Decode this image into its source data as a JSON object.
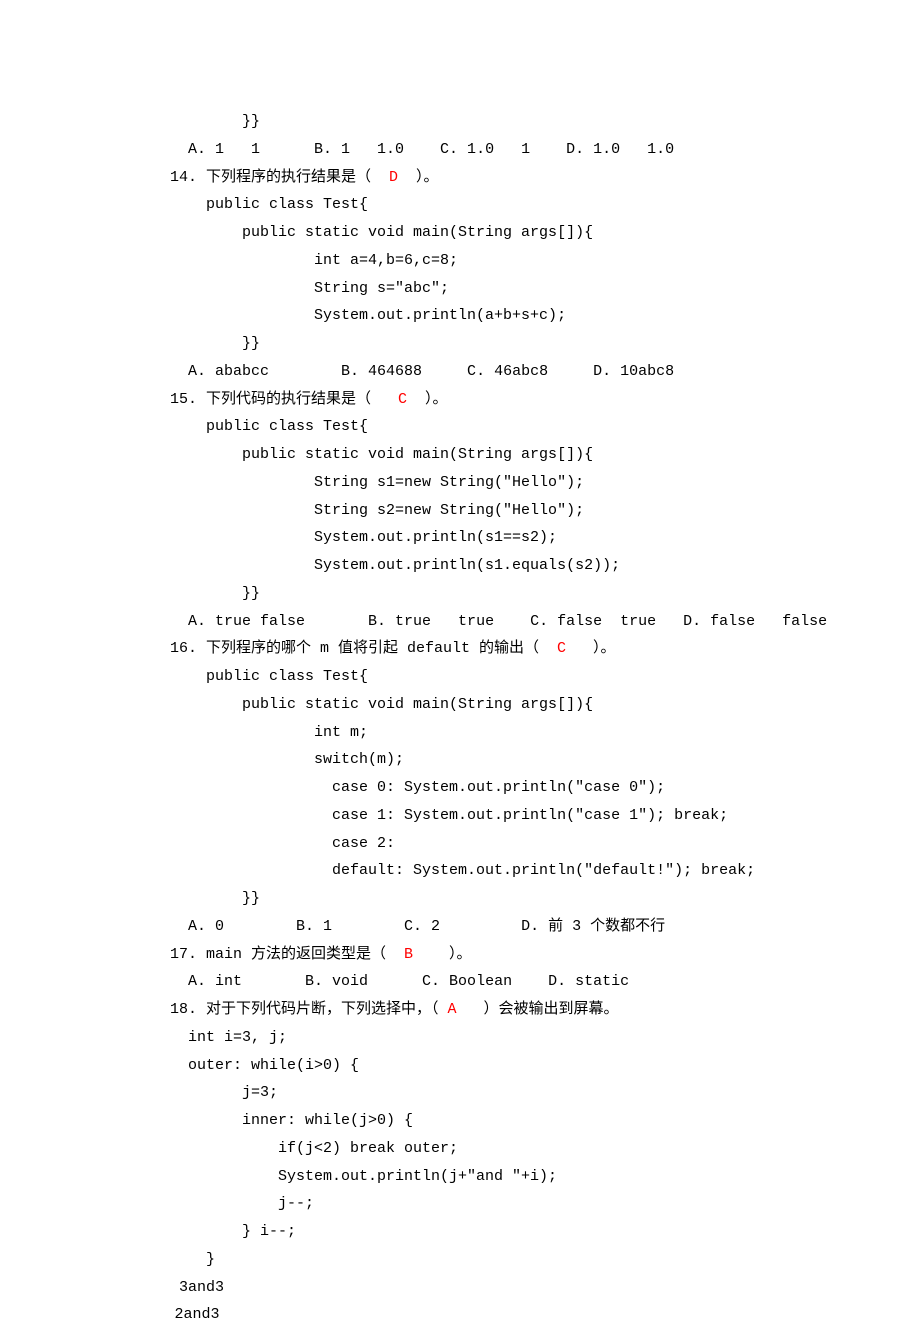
{
  "lines": [
    {
      "indent": 4,
      "text": "}}"
    },
    {
      "indent": 1,
      "segments": [
        {
          "text": "A. 1   1      B. 1   1.0    C. 1.0   1    D. 1.0   1.0"
        }
      ]
    },
    {
      "indent": 0,
      "segments": [
        {
          "text": "14. 下列程序的执行结果是（  "
        },
        {
          "text": "D",
          "red": true
        },
        {
          "text": "  ）。"
        }
      ]
    },
    {
      "indent": 2,
      "text": "public class Test{"
    },
    {
      "indent": 4,
      "text": "public static void main(String args[]){"
    },
    {
      "indent": 8,
      "text": "int a=4,b=6,c=8;"
    },
    {
      "indent": 8,
      "text": "String s=\"abc\";"
    },
    {
      "indent": 8,
      "text": "System.out.println(a+b+s+c);"
    },
    {
      "indent": 4,
      "text": "}}"
    },
    {
      "indent": 1,
      "segments": [
        {
          "text": "A. ababcc        B. 464688     C. 46abc8     D. 10abc8"
        }
      ]
    },
    {
      "indent": 0,
      "segments": [
        {
          "text": "15. 下列代码的执行结果是（   "
        },
        {
          "text": "C",
          "red": true
        },
        {
          "text": "  ）。"
        }
      ]
    },
    {
      "indent": 2,
      "text": "public class Test{"
    },
    {
      "indent": 4,
      "text": "public static void main(String args[]){"
    },
    {
      "indent": 8,
      "text": "String s1=new String(\"Hello\");"
    },
    {
      "indent": 8,
      "text": "String s2=new String(\"Hello\");"
    },
    {
      "indent": 8,
      "text": "System.out.println(s1==s2);"
    },
    {
      "indent": 8,
      "text": "System.out.println(s1.equals(s2));"
    },
    {
      "indent": 4,
      "text": "}}"
    },
    {
      "indent": 1,
      "segments": [
        {
          "text": "A. true false       B. true   true    C. false  true   D. false   false"
        }
      ]
    },
    {
      "indent": 0,
      "segments": [
        {
          "text": "16. 下列程序的哪个 m 值将引起 default 的输出（  "
        },
        {
          "text": "C",
          "red": true
        },
        {
          "text": "   ）。"
        }
      ]
    },
    {
      "indent": 2,
      "text": "public class Test{"
    },
    {
      "indent": 4,
      "text": "public static void main(String args[]){"
    },
    {
      "indent": 8,
      "text": "int m;"
    },
    {
      "indent": 8,
      "text": "switch(m);"
    },
    {
      "indent": 9,
      "text": "case 0: System.out.println(\"case 0\");"
    },
    {
      "indent": 9,
      "text": "case 1: System.out.println(\"case 1\"); break;"
    },
    {
      "indent": 9,
      "text": "case 2:"
    },
    {
      "indent": 9,
      "text": "default: System.out.println(\"default!\"); break;"
    },
    {
      "indent": 4,
      "text": "}}"
    },
    {
      "indent": 1,
      "segments": [
        {
          "text": "A. 0        B. 1        C. 2         D. 前 3 个数都不行"
        }
      ]
    },
    {
      "indent": 0,
      "segments": [
        {
          "text": "17. main 方法的返回类型是（  "
        },
        {
          "text": "B",
          "red": true
        },
        {
          "text": "    ）。"
        }
      ]
    },
    {
      "indent": 1,
      "segments": [
        {
          "text": "A. int       B. void      C. Boolean    D. static"
        }
      ]
    },
    {
      "indent": 0,
      "segments": [
        {
          "text": "18. 对于下列代码片断，下列选择中，（ "
        },
        {
          "text": "A",
          "red": true
        },
        {
          "text": "   ）会被输出到屏幕。"
        }
      ]
    },
    {
      "indent": 1,
      "text": "int i=3, j;"
    },
    {
      "indent": 1,
      "text": "outer: while(i>0) {"
    },
    {
      "indent": 4,
      "text": "j=3;"
    },
    {
      "indent": 4,
      "text": "inner: while(j>0) {"
    },
    {
      "indent": 6,
      "text": "if(j<2) break outer;"
    },
    {
      "indent": 6,
      "text": "System.out.println(j+\"and \"+i);"
    },
    {
      "indent": 6,
      "text": "j--;"
    },
    {
      "indent": 4,
      "text": "} i--;"
    },
    {
      "indent": 2,
      "text": "}"
    },
    {
      "indent": 0.5,
      "text": "3and3"
    },
    {
      "indent": -0.5,
      "text": "2and3"
    }
  ]
}
